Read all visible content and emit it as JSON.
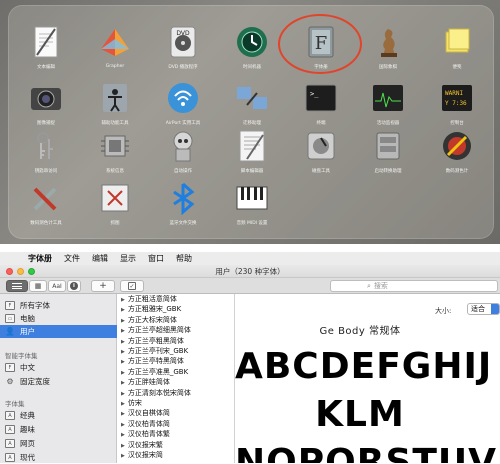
{
  "launchpad": {
    "apps": [
      {
        "label": "文本编辑",
        "icon": "textedit-icon"
      },
      {
        "label": "Grapher",
        "icon": "grapher-icon"
      },
      {
        "label": "DVD 播放程序",
        "icon": "dvd-player-icon"
      },
      {
        "label": "时间机器",
        "icon": "time-machine-icon"
      },
      {
        "label": "字体册",
        "icon": "font-book-icon"
      },
      {
        "label": "国际象棋",
        "icon": "chess-icon"
      },
      {
        "label": "便笺",
        "icon": "stickies-icon"
      },
      {
        "label": "图像捕捉",
        "icon": "image-capture-icon"
      },
      {
        "label": "辅助功能工具",
        "icon": "accessibility-icon"
      },
      {
        "label": "AirPort 实用工具",
        "icon": "airport-icon"
      },
      {
        "label": "迁移助理",
        "icon": "migration-icon"
      },
      {
        "label": "终端",
        "icon": "terminal-icon"
      },
      {
        "label": "活动监视器",
        "icon": "activity-monitor-icon"
      },
      {
        "label": "控制台",
        "icon": "console-icon"
      },
      {
        "label": "钥匙串访问",
        "icon": "keychain-icon"
      },
      {
        "label": "系统信息",
        "icon": "system-info-icon"
      },
      {
        "label": "自动操作",
        "icon": "automator-icon"
      },
      {
        "label": "脚本编辑器",
        "icon": "script-editor-icon"
      },
      {
        "label": "磁盘工具",
        "icon": "disk-utility-icon"
      },
      {
        "label": "启动转换助理",
        "icon": "bootcamp-icon"
      },
      {
        "label": "数码测色计",
        "icon": "colorimeter-icon"
      },
      {
        "label": "数码测色计工具",
        "icon": "tools-icon"
      },
      {
        "label": "抓图",
        "icon": "grab-icon"
      },
      {
        "label": "蓝牙文件交换",
        "icon": "bluetooth-icon"
      },
      {
        "label": "音频 MIDI 设置",
        "icon": "midi-icon"
      }
    ]
  },
  "menubar": {
    "app_name": "字体册",
    "items": [
      "文件",
      "编辑",
      "显示",
      "窗口",
      "帮助"
    ]
  },
  "window": {
    "title": "用户（230 种字体）",
    "search_placeholder": "搜索",
    "toolbar": {
      "add": "+",
      "check": "✓",
      "sample_aa": "AaI",
      "info": "i"
    }
  },
  "sidebar": {
    "collections": [
      {
        "label": "所有字体",
        "icon": "font-collection-icon"
      },
      {
        "label": "电脑",
        "icon": "computer-icon"
      },
      {
        "label": "用户",
        "icon": "user-icon"
      }
    ],
    "smart_header": "智能字体集",
    "smart": [
      {
        "label": "中文",
        "icon": "chinese-icon"
      },
      {
        "label": "固定宽度",
        "icon": "fixed-width-icon"
      }
    ],
    "sets_header": "字体集",
    "sets": [
      {
        "label": "经典",
        "icon": "classic-icon"
      },
      {
        "label": "趣味",
        "icon": "fun-icon"
      },
      {
        "label": "网页",
        "icon": "web-icon"
      },
      {
        "label": "现代",
        "icon": "modern-icon"
      }
    ]
  },
  "fontlist": {
    "items": [
      "方正粗活意简体",
      "方正粗雅宋_GBK",
      "方正大标宋简体",
      "方正兰亭超细黑简体",
      "方正兰亭粗黑简体",
      "方正兰亭刊宋_GBK",
      "方正兰亭特黑简体",
      "方正兰亭准黑_GBK",
      "方正胖娃简体",
      "方正清刻本悦宋简体",
      "仿宋",
      "汉仪自棋体简",
      "汉仪柏青体简",
      "汉仪柏青体繁",
      "汉仪报宋繁",
      "汉仪报宋简"
    ]
  },
  "preview": {
    "size_label": "大小:",
    "size_value": "适合",
    "font_name": "Ge Body 常规体",
    "sample_lines": [
      "ABCDEFGHIJ",
      "KLM",
      "NOPQRSTUV"
    ]
  }
}
